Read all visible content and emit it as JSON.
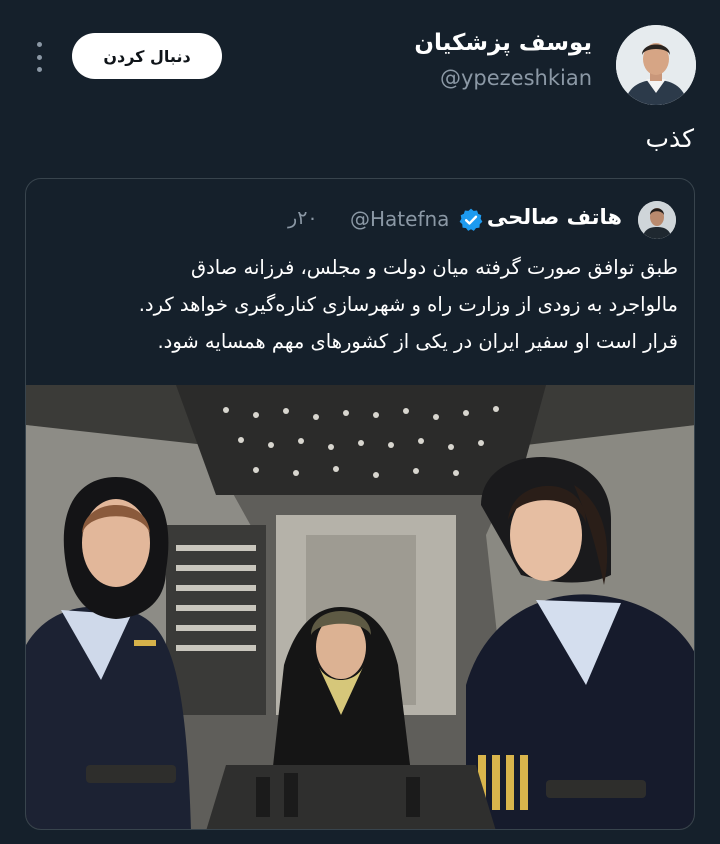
{
  "author": {
    "name": "یوسف پزشکیان",
    "handle": "@ypezeshkian"
  },
  "actions": {
    "follow_label": "دنبال کردن"
  },
  "tweet": {
    "text": "کذب"
  },
  "quoted": {
    "name": "هاتف صالحی",
    "handle": "@Hatefna",
    "time": "۲۰ر",
    "lines": [
      "طبق توافق صورت گرفته میان دولت و مجلس، فرزانه صادق",
      "مالواجرد به زودی از وزارت راه و شهرسازی کناره‌گیری خواهد کرد.",
      "قرار است او سفیر ایران در یکی از کشورهای مهم همسایه شود."
    ]
  },
  "colors": {
    "background": "#15202b",
    "verified": "#1d9bf0",
    "muted_text": "#8b98a5"
  },
  "icons": [
    "more-options-icon",
    "verified-badge-icon"
  ]
}
